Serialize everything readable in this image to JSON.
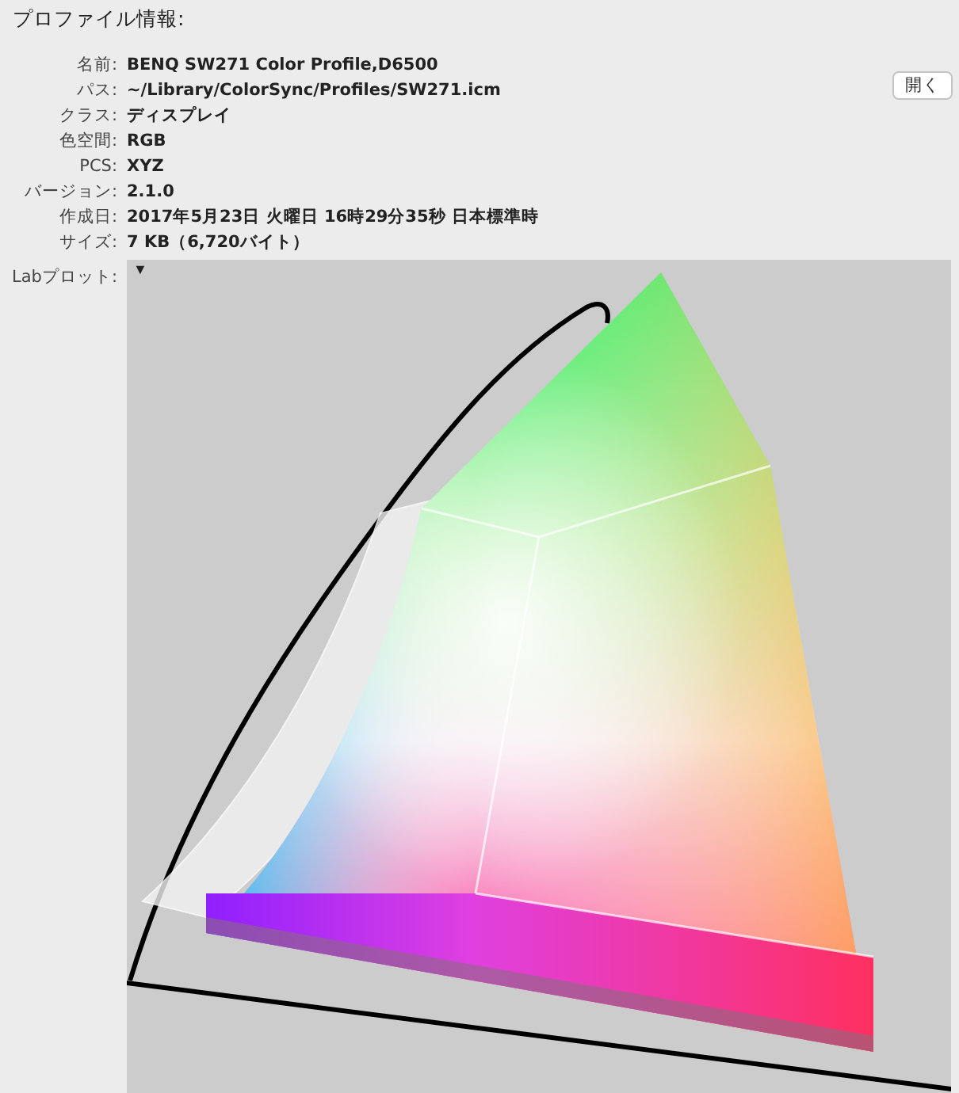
{
  "section_title": "プロファイル情報:",
  "fields": [
    {
      "label": "名前:",
      "value": "BENQ SW271 Color Profile,D6500"
    },
    {
      "label": "パス:",
      "value": "~/Library/ColorSync/Profiles/SW271.icm"
    },
    {
      "label": "クラス:",
      "value": "ディスプレイ"
    },
    {
      "label": "色空間:",
      "value": "RGB"
    },
    {
      "label": "PCS:",
      "value": "XYZ"
    },
    {
      "label": "バージョン:",
      "value": "2.1.0"
    },
    {
      "label": "作成日:",
      "value": "2017年5月23日 火曜日 16時29分35秒 日本標準時"
    },
    {
      "label": "サイズ:",
      "value": "7 KB（6,720バイト）"
    }
  ],
  "open_button": "開く",
  "lab_plot": {
    "label": "Labプロット:",
    "menu_toggle": "▼"
  }
}
